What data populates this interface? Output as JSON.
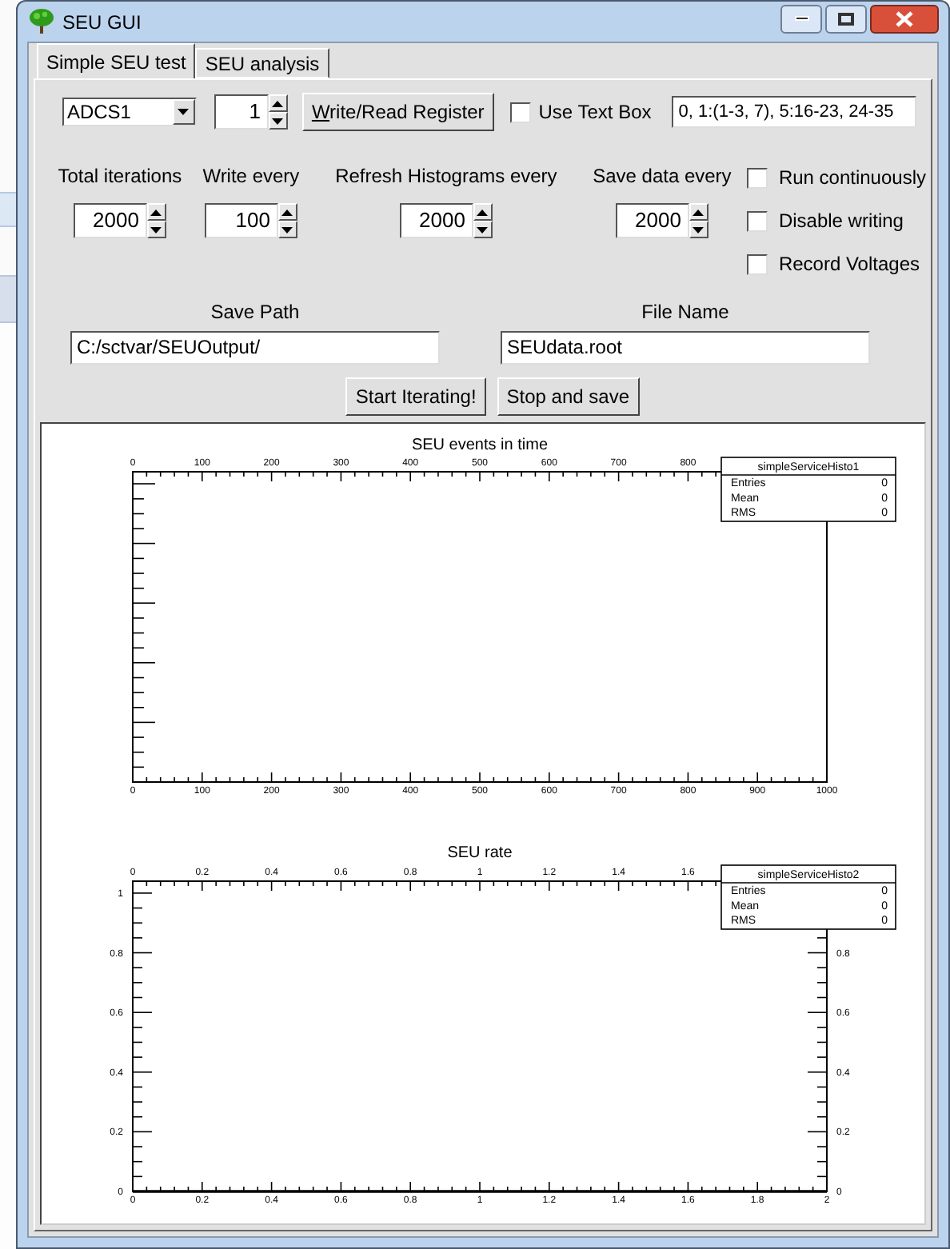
{
  "window": {
    "title": "SEU GUI"
  },
  "tabs": [
    {
      "label": "Simple SEU test",
      "selected": true
    },
    {
      "label": "SEU analysis",
      "selected": false
    }
  ],
  "register": {
    "combo": "ADCS1",
    "spinner": "1",
    "button": "Write/Read Register"
  },
  "use_text_box": {
    "label": "Use Text Box",
    "checked": false
  },
  "channels_field": {
    "value": "0, 1:(1-3, 7), 5:16-23, 24-35"
  },
  "settings": [
    {
      "label": "Total iterations",
      "value": "2000"
    },
    {
      "label": "Write every",
      "value": "100"
    },
    {
      "label": "Refresh Histograms every",
      "value": "2000"
    },
    {
      "label": "Save data every",
      "value": "2000"
    }
  ],
  "options": [
    {
      "label": "Run continuously",
      "checked": false
    },
    {
      "label": "Disable writing",
      "checked": false
    },
    {
      "label": "Record Voltages",
      "checked": false
    }
  ],
  "save_path": {
    "label": "Save Path",
    "value": "C:/sctvar/SEUOutput/"
  },
  "file_name": {
    "label": "File Name",
    "value": "SEUdata.root"
  },
  "buttons": [
    "Start Iterating!",
    "Stop and save"
  ],
  "charts": [
    {
      "kind": "time",
      "top_axis_labels": [
        "0",
        "100",
        "200",
        "300",
        "400",
        "500",
        "600",
        "700",
        "800"
      ],
      "stats": {
        "title": "simpleServiceHisto1",
        "rows": [
          {
            "name": "Entries",
            "value": "0"
          },
          {
            "name": "Mean",
            "value": "0"
          },
          {
            "name": "RMS",
            "value": "0"
          }
        ]
      },
      "title": "SEU events in time",
      "bottom_axis_labels": [
        "0",
        "100",
        "200",
        "300",
        "400",
        "500",
        "600",
        "700",
        "800",
        "900",
        "1000"
      ]
    },
    {
      "kind": "rate",
      "top_axis_labels": [
        "0",
        "0.2",
        "0.4",
        "0.6",
        "0.8",
        "1",
        "1.2",
        "1.4",
        "1.6"
      ],
      "right_axis_labels": [
        "0.8",
        "0.6",
        "0.4",
        "0.2",
        "0"
      ],
      "stats": {
        "title": "simpleServiceHisto2",
        "rows": [
          {
            "name": "Entries",
            "value": "0"
          },
          {
            "name": "Mean",
            "value": "0"
          },
          {
            "name": "RMS",
            "value": "0"
          }
        ]
      },
      "chart_data": {
        "type": "line",
        "title": "SEU rate",
        "x": [
          0,
          2
        ],
        "series": [
          {
            "color": "#000000",
            "values": [
              0,
              0
            ]
          }
        ],
        "xlim": [
          0,
          2
        ],
        "ylim": [
          0,
          1.04
        ],
        "xticks": [
          0,
          0.2,
          0.4,
          0.6,
          0.8,
          1,
          1.2,
          1.4,
          1.6,
          1.8,
          2
        ],
        "yticks": [
          0,
          0.2,
          0.4,
          0.6,
          0.8,
          1
        ]
      }
    }
  ]
}
